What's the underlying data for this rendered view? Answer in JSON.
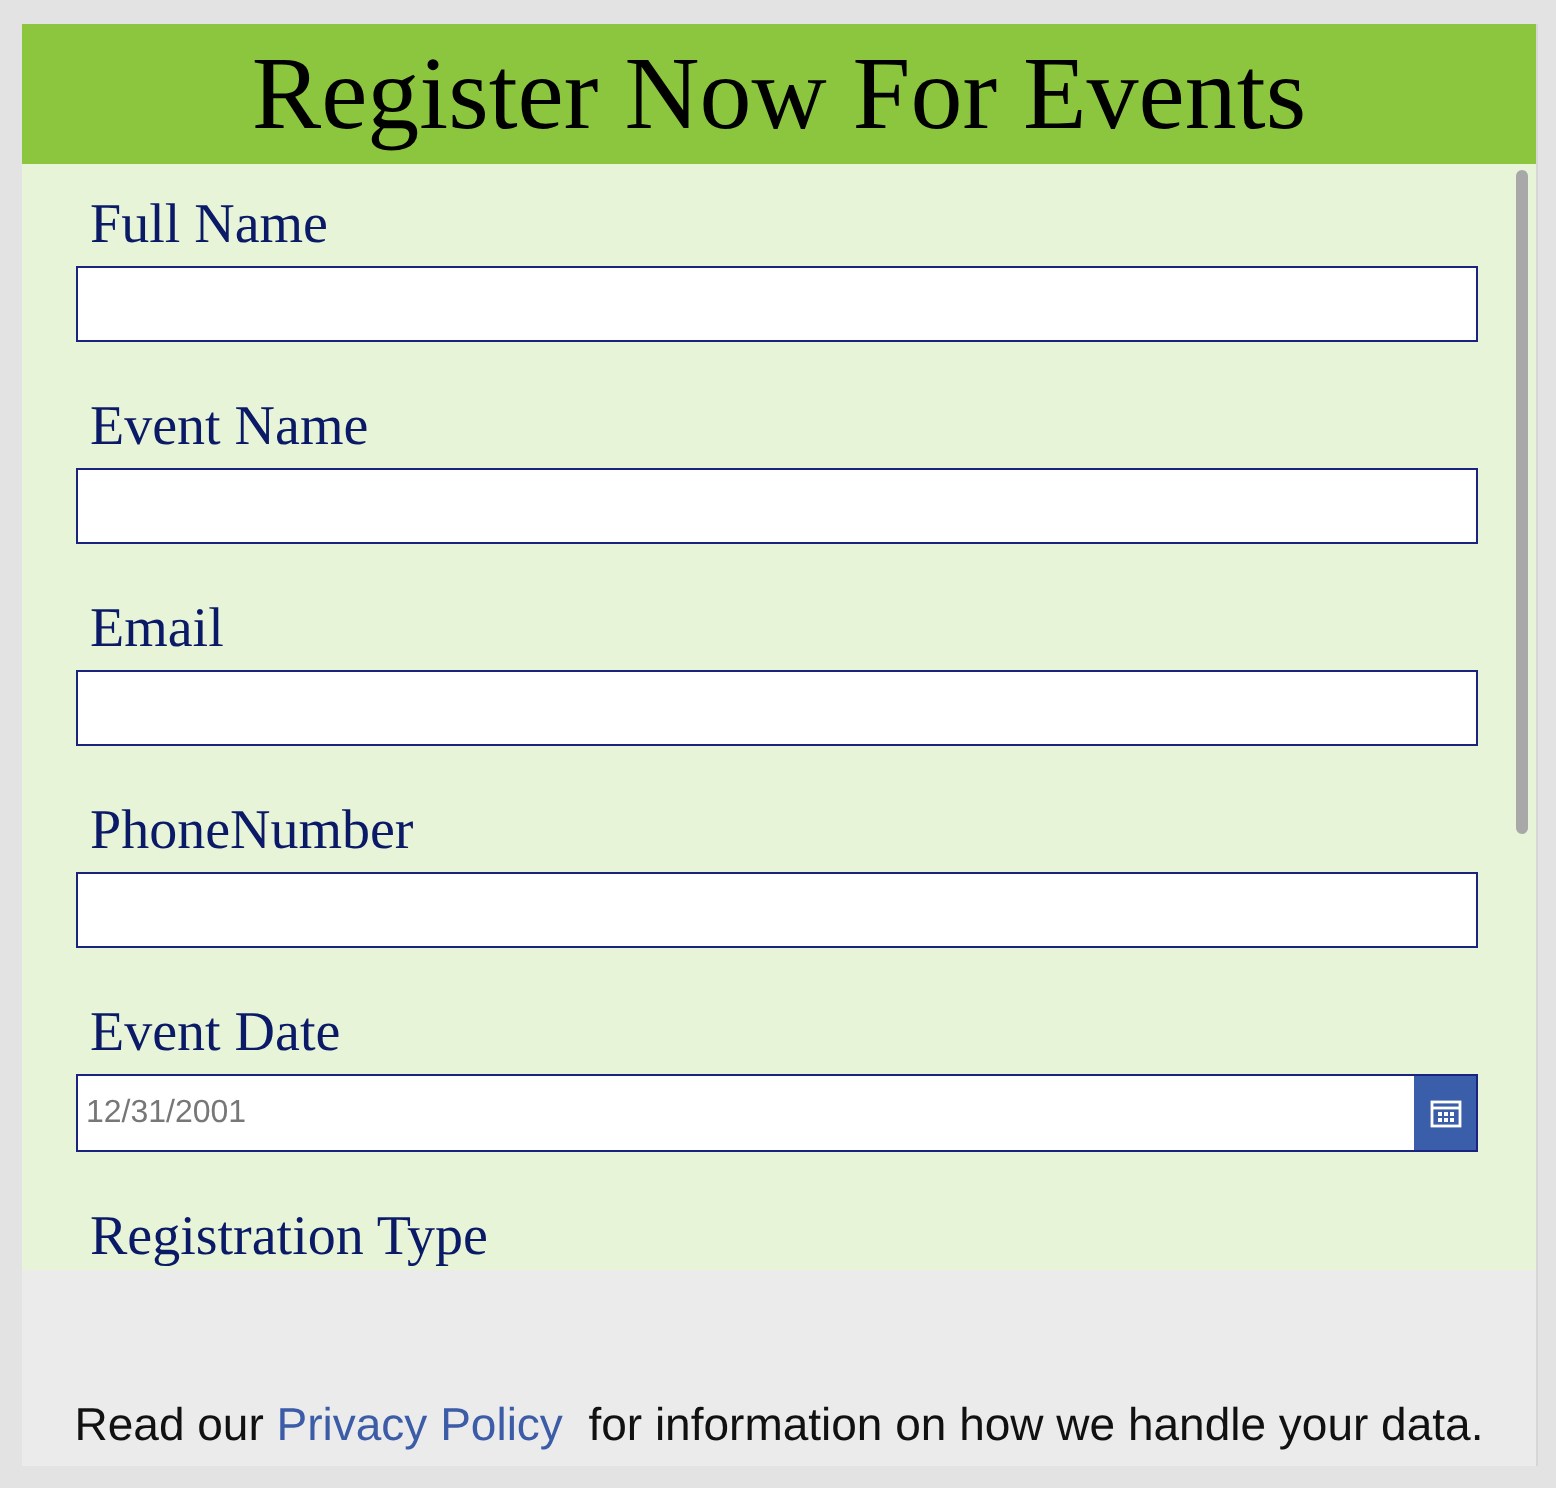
{
  "header": {
    "title": "Register Now For Events"
  },
  "fields": [
    {
      "kind": "text",
      "label": "Full Name"
    },
    {
      "kind": "text",
      "label": "Event Name"
    },
    {
      "kind": "text",
      "label": "Email"
    },
    {
      "kind": "text",
      "label": "PhoneNumber"
    },
    {
      "kind": "date",
      "label": "Event Date",
      "placeholder": "12/31/2001"
    },
    {
      "kind": "heading",
      "label": "Registration Type"
    }
  ],
  "footer": {
    "before": "Read our",
    "link": "Privacy Policy",
    "after": "for information on how we handle your data."
  }
}
